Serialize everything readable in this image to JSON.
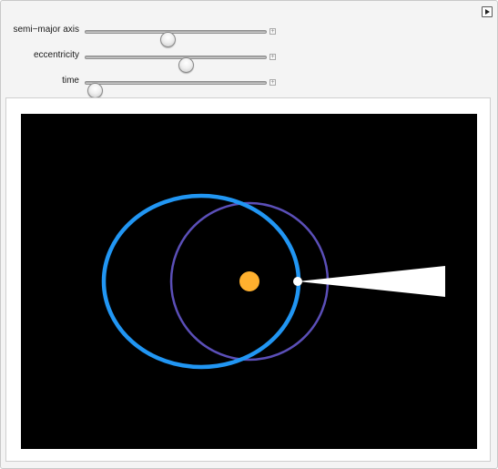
{
  "controls": [
    {
      "id": "semi-major-axis",
      "label": "semi−major axis",
      "value_fraction": 0.45
    },
    {
      "id": "eccentricity",
      "label": "eccentricity",
      "value_fraction": 0.55
    },
    {
      "id": "time",
      "label": "time",
      "value_fraction": 0.05
    }
  ],
  "icons": {
    "plus": "plus-icon",
    "options_menu": "triangle-right-icon"
  },
  "colors": {
    "canvas_bg": "#000000",
    "orbit_blue": "#2196f3",
    "orbit_purple": "#5b4fb8",
    "sun": "#ffb02e",
    "planet": "#ffffff",
    "beam": "#ffffff"
  }
}
